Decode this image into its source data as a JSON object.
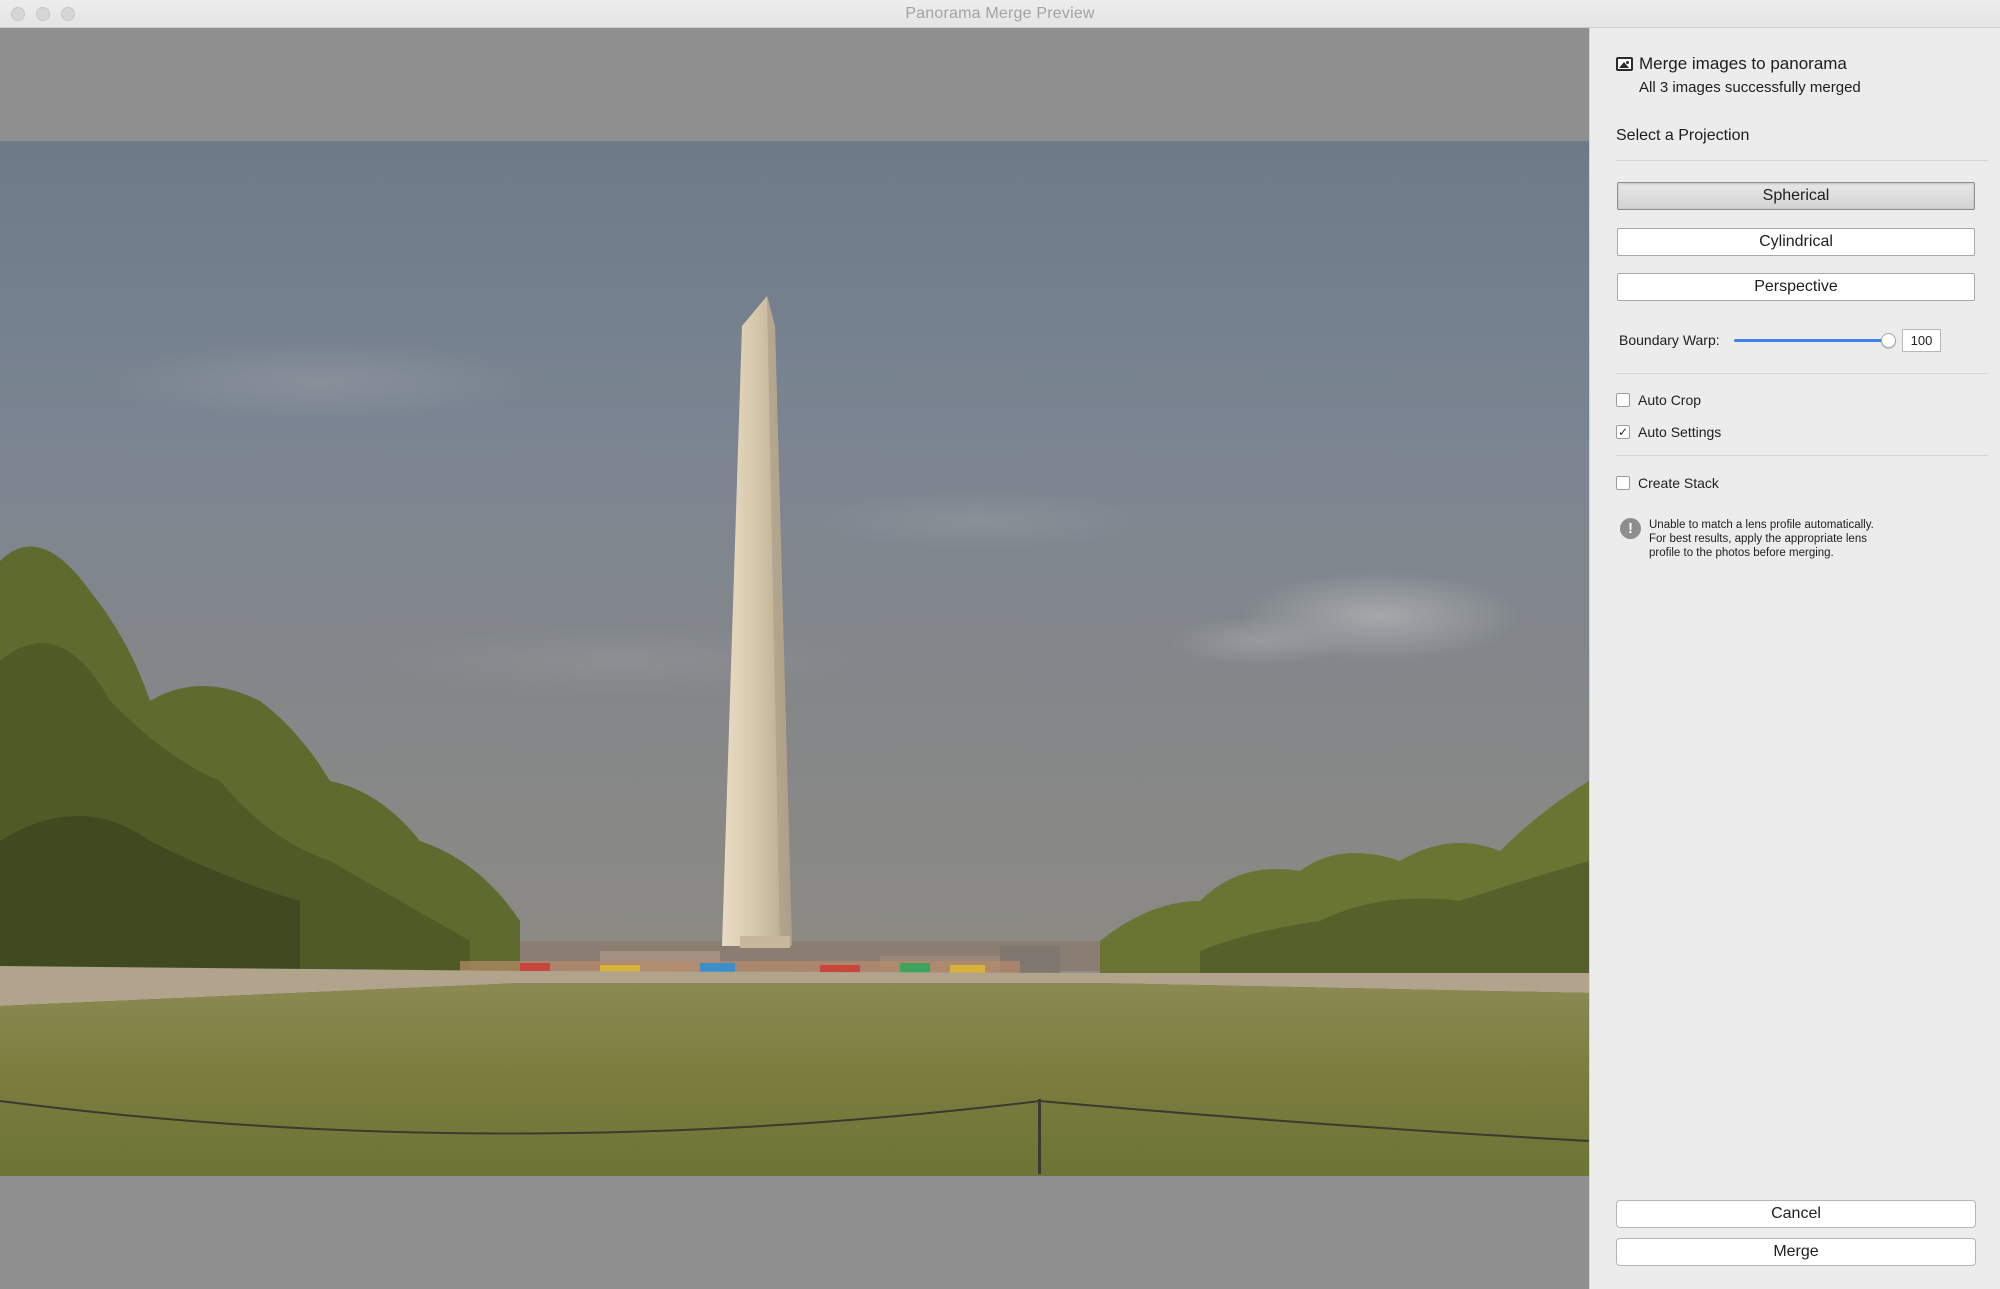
{
  "window": {
    "title": "Panorama Merge Preview"
  },
  "preview": {
    "image_icon": "panorama-photo-washington-monument"
  },
  "panel": {
    "header": {
      "icon": "panorama-image-icon",
      "title": "Merge images to panorama",
      "subtitle": "All 3 images successfully merged"
    },
    "projection": {
      "label": "Select a Projection",
      "options": [
        "Spherical",
        "Cylindrical",
        "Perspective"
      ],
      "selected": "Spherical"
    },
    "boundary_warp": {
      "label": "Boundary Warp:",
      "value": "100",
      "fraction": 1.0,
      "accent": "#3b82ea"
    },
    "options": {
      "auto_crop": {
        "label": "Auto Crop",
        "checked": false
      },
      "auto_settings": {
        "label": "Auto Settings",
        "checked": true
      },
      "create_stack": {
        "label": "Create Stack",
        "checked": false
      }
    },
    "warning": {
      "icon": "exclamation-icon",
      "lines": [
        "Unable to match a lens profile automatically.",
        "For best results, apply the appropriate lens",
        "profile to the photos before merging."
      ]
    },
    "actions": {
      "cancel": "Cancel",
      "merge": "Merge"
    }
  }
}
